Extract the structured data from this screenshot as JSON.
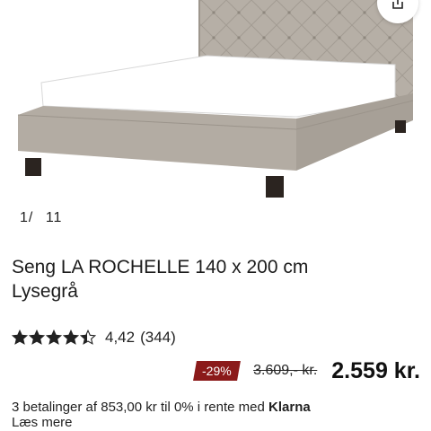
{
  "gallery": {
    "current": "1",
    "total": "11",
    "separator": "/"
  },
  "product": {
    "title_line1": "Seng LA ROCHELLE 140 x 200 cm",
    "title_line2": "Lysegrå"
  },
  "rating": {
    "value": "4,42",
    "count": "(344)",
    "stars": 4.42,
    "max": 5
  },
  "price": {
    "discount": "-29%",
    "old": "3.609,- kr.",
    "current": "2.559 kr."
  },
  "installments": {
    "text": "3 betalinger af 853,00 kr til 0% i rente med",
    "provider": "Klarna",
    "read_more": "Læs mere"
  },
  "colors": {
    "discount_bg": "#8b1a1a",
    "upholstery": "#b3aca3",
    "mattress": "#ffffff",
    "legs": "#2b2420"
  },
  "icons": {
    "share": "share-icon",
    "star": "star-icon"
  }
}
